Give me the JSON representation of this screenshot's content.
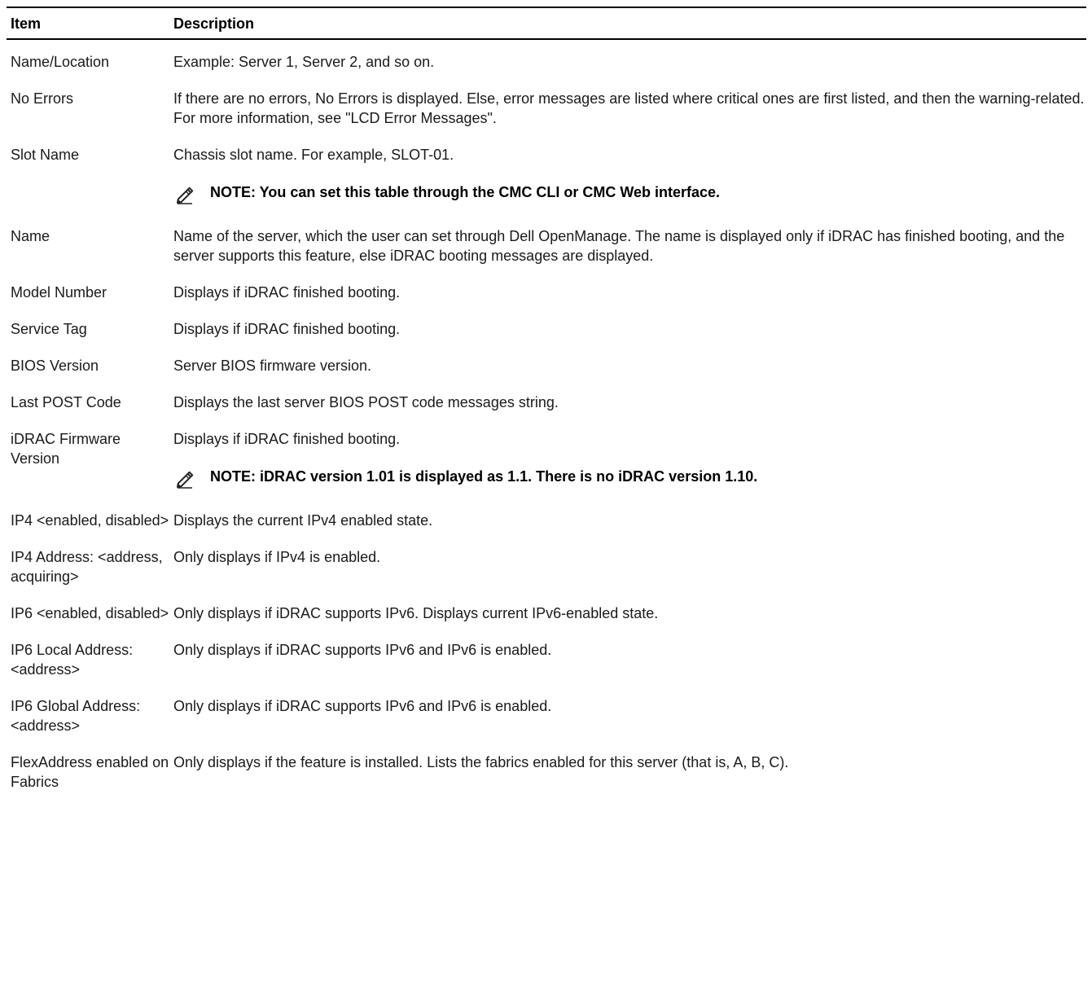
{
  "table": {
    "headers": {
      "item": "Item",
      "description": "Description"
    },
    "rows": [
      {
        "item": "Name/Location",
        "description": "Example: Server 1, Server 2, and so on."
      },
      {
        "item": "No Errors",
        "description": "If there are no errors, No Errors is displayed. Else, error messages are listed where critical ones are first listed, and then the warning-related. For more information, see \"LCD Error Messages\"."
      },
      {
        "item": "Slot Name",
        "description": "Chassis slot name. For example, SLOT-01.",
        "note": "NOTE: You can set this table through the CMC CLI or CMC Web interface.",
        "note_icon": "note-pencil-icon"
      },
      {
        "item": "Name",
        "description": "Name of the server, which the user can set through Dell OpenManage. The name is displayed only if iDRAC has finished booting, and the server supports this feature, else iDRAC booting messages are displayed."
      },
      {
        "item": "Model Number",
        "description": "Displays if iDRAC finished booting."
      },
      {
        "item": "Service Tag",
        "description": "Displays if iDRAC finished booting."
      },
      {
        "item": "BIOS Version",
        "description": "Server BIOS firmware version."
      },
      {
        "item": "Last POST Code",
        "description": "Displays the last server BIOS POST code messages string."
      },
      {
        "item": "iDRAC Firmware Version",
        "description": "Displays if iDRAC finished booting.",
        "note": "NOTE: iDRAC version 1.01 is displayed as 1.1. There is no iDRAC version 1.10.",
        "note_icon": "note-pencil-icon"
      },
      {
        "item": "IP4 <enabled, disabled>",
        "description": "Displays the current IPv4 enabled state."
      },
      {
        "item": "IP4 Address: <address, acquiring>",
        "description": "Only displays if IPv4 is enabled."
      },
      {
        "item": "IP6 <enabled, disabled>",
        "description": "Only displays if iDRAC supports IPv6. Displays current IPv6-enabled state."
      },
      {
        "item": "IP6 Local Address: <address>",
        "description": "Only displays if iDRAC supports IPv6 and IPv6 is enabled."
      },
      {
        "item": "IP6 Global Address: <address>",
        "description": "Only displays if iDRAC supports IPv6 and IPv6 is enabled."
      },
      {
        "item": "FlexAddress enabled on Fabrics",
        "description": "Only displays if the feature is installed. Lists the fabrics enabled for this server (that is, A, B, C)."
      }
    ]
  }
}
